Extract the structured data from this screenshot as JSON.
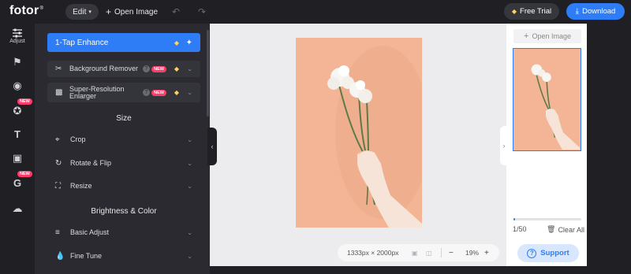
{
  "topbar": {
    "logo": "fotor",
    "logo_mark": "®",
    "edit_label": "Edit",
    "open_image_label": "Open Image",
    "free_trial_label": "Free Trial",
    "download_label": "Download"
  },
  "rail": {
    "adjust_label": "Adjust",
    "new_badge": "NEW"
  },
  "panel": {
    "enhance_label": "1-Tap Enhance",
    "bg_remover_label": "Background Remover",
    "super_res_line1": "Super-Resolution",
    "super_res_line2": "Enlarger",
    "new_badge": "NEW",
    "help_mark": "?",
    "size_title": "Size",
    "crop_label": "Crop",
    "rotate_label": "Rotate & Flip",
    "resize_label": "Resize",
    "brightness_title": "Brightness & Color",
    "basic_adjust_label": "Basic Adjust",
    "fine_tune_label": "Fine Tune"
  },
  "canvas": {
    "dimensions": "1333px × 2000px",
    "zoom": "19%"
  },
  "right_panel": {
    "open_image_label": "Open Image",
    "count": "1/50",
    "clear_all_label": "Clear All",
    "support_label": "Support",
    "progress_fraction": 0.02
  },
  "colors": {
    "accent": "#2f7df6",
    "new_badge": "#ff3b6b",
    "premium_gem": "#ffd25a",
    "photo_background": "#f3b595"
  }
}
